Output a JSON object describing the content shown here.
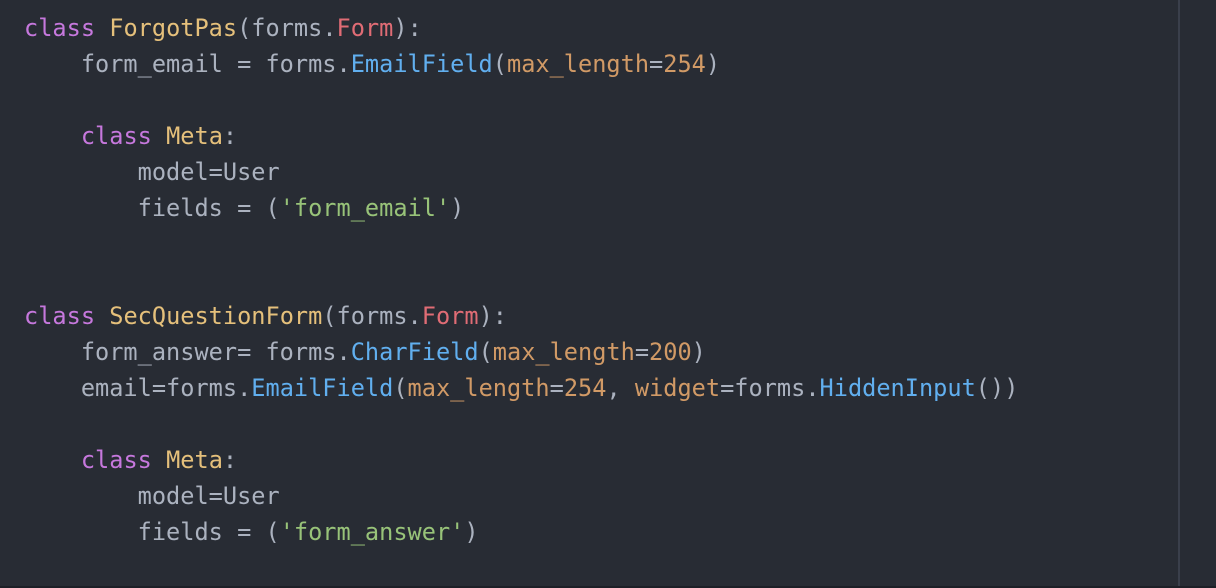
{
  "theme": {
    "background": "#282c34",
    "keyword": "#c678dd",
    "class_name": "#e5c07b",
    "plain": "#abb2bf",
    "builtin": "#e06c75",
    "function": "#61afef",
    "number_param": "#d19a66",
    "string": "#98c379"
  },
  "code": {
    "lines": [
      [
        {
          "t": "class",
          "k": "keyword"
        },
        {
          "t": " ",
          "k": "plain"
        },
        {
          "t": "ForgotPas",
          "k": "class"
        },
        {
          "t": "(forms.",
          "k": "plain"
        },
        {
          "t": "Form",
          "k": "builtin"
        },
        {
          "t": "):",
          "k": "plain"
        }
      ],
      [
        {
          "t": "    form_email = forms.",
          "k": "plain"
        },
        {
          "t": "EmailField",
          "k": "func"
        },
        {
          "t": "(",
          "k": "plain"
        },
        {
          "t": "max_length",
          "k": "param"
        },
        {
          "t": "=",
          "k": "plain"
        },
        {
          "t": "254",
          "k": "number"
        },
        {
          "t": ")",
          "k": "plain"
        }
      ],
      [],
      [
        {
          "t": "    ",
          "k": "plain"
        },
        {
          "t": "class",
          "k": "keyword"
        },
        {
          "t": " ",
          "k": "plain"
        },
        {
          "t": "Meta",
          "k": "class"
        },
        {
          "t": ":",
          "k": "plain"
        }
      ],
      [
        {
          "t": "        model=User",
          "k": "plain"
        }
      ],
      [
        {
          "t": "        fields = (",
          "k": "plain"
        },
        {
          "t": "'form_email'",
          "k": "string"
        },
        {
          "t": ")",
          "k": "plain"
        }
      ],
      [],
      [],
      [
        {
          "t": "class",
          "k": "keyword"
        },
        {
          "t": " ",
          "k": "plain"
        },
        {
          "t": "SecQuestionForm",
          "k": "class"
        },
        {
          "t": "(forms.",
          "k": "plain"
        },
        {
          "t": "Form",
          "k": "builtin"
        },
        {
          "t": "):",
          "k": "plain"
        }
      ],
      [
        {
          "t": "    form_answer= forms.",
          "k": "plain"
        },
        {
          "t": "CharField",
          "k": "func"
        },
        {
          "t": "(",
          "k": "plain"
        },
        {
          "t": "max_length",
          "k": "param"
        },
        {
          "t": "=",
          "k": "plain"
        },
        {
          "t": "200",
          "k": "number"
        },
        {
          "t": ")",
          "k": "plain"
        }
      ],
      [
        {
          "t": "    email=forms.",
          "k": "plain"
        },
        {
          "t": "EmailField",
          "k": "func"
        },
        {
          "t": "(",
          "k": "plain"
        },
        {
          "t": "max_length",
          "k": "param"
        },
        {
          "t": "=",
          "k": "plain"
        },
        {
          "t": "254",
          "k": "number"
        },
        {
          "t": ", ",
          "k": "plain"
        },
        {
          "t": "widget",
          "k": "param"
        },
        {
          "t": "=forms.",
          "k": "plain"
        },
        {
          "t": "HiddenInput",
          "k": "func"
        },
        {
          "t": "())",
          "k": "plain"
        }
      ],
      [],
      [
        {
          "t": "    ",
          "k": "plain"
        },
        {
          "t": "class",
          "k": "keyword"
        },
        {
          "t": " ",
          "k": "plain"
        },
        {
          "t": "Meta",
          "k": "class"
        },
        {
          "t": ":",
          "k": "plain"
        }
      ],
      [
        {
          "t": "        model=User",
          "k": "plain"
        }
      ],
      [
        {
          "t": "        fields = (",
          "k": "plain"
        },
        {
          "t": "'form_answer'",
          "k": "string"
        },
        {
          "t": ")",
          "k": "plain"
        }
      ]
    ]
  }
}
